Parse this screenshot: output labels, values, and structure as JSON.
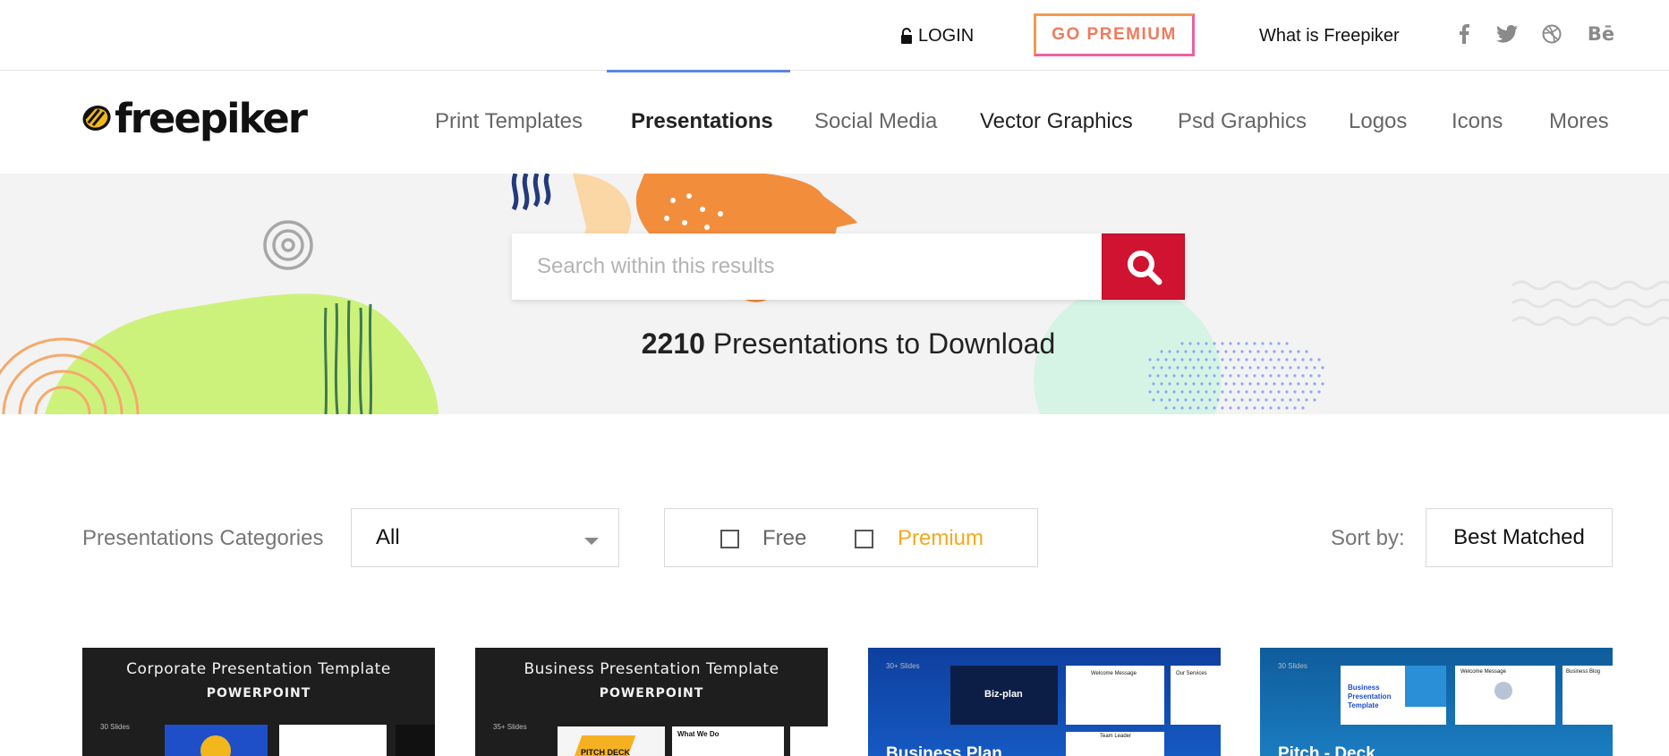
{
  "topbar": {
    "login_label": "LOGIN",
    "premium_label": "GO PREMIUM",
    "what_is_label": "What is Freepiker",
    "social_icons": [
      "facebook-icon",
      "twitter-icon",
      "dribbble-icon",
      "behance-icon"
    ],
    "behance_text": "Bē"
  },
  "brand": {
    "logo_text": "freepiker"
  },
  "nav": {
    "items": [
      {
        "label": "Print Templates"
      },
      {
        "label": "Presentations",
        "active": true
      },
      {
        "label": "Social Media"
      },
      {
        "label": "Vector Graphics"
      },
      {
        "label": "Psd Graphics"
      },
      {
        "label": "Logos"
      },
      {
        "label": "Icons"
      },
      {
        "label": "Mores"
      }
    ],
    "active_color": "#5b84e8"
  },
  "search": {
    "placeholder": "Search within this results",
    "button_color": "#d01330"
  },
  "results": {
    "count": "2210",
    "text": "Presentations to Download"
  },
  "filters": {
    "category_label": "Presentations Categories",
    "category_value": "All",
    "free_label": "Free",
    "premium_label": "Premium",
    "sort_label": "Sort by:",
    "sort_value": "Best Matched"
  },
  "cards": [
    {
      "title": "Corporate Presentation Template",
      "subtitle": "POWERPOINT",
      "slides": "30 Slides"
    },
    {
      "title": "Business Presentation Template",
      "subtitle": "POWERPOINT",
      "slides": "35+ Slides",
      "thumb_labels": [
        "PITCH DECK",
        "What We Do"
      ]
    },
    {
      "title": "Business Plan",
      "slides": "30+ Slides",
      "thumb_labels": [
        "Biz-plan",
        "Welcome Message",
        "Our Services",
        "Team Leader"
      ]
    },
    {
      "title": "Pitch - Deck",
      "slides": "30 Slides",
      "thumb_labels": [
        "Business Presentation Template",
        "Welcome Message",
        "Business Blog"
      ]
    }
  ]
}
